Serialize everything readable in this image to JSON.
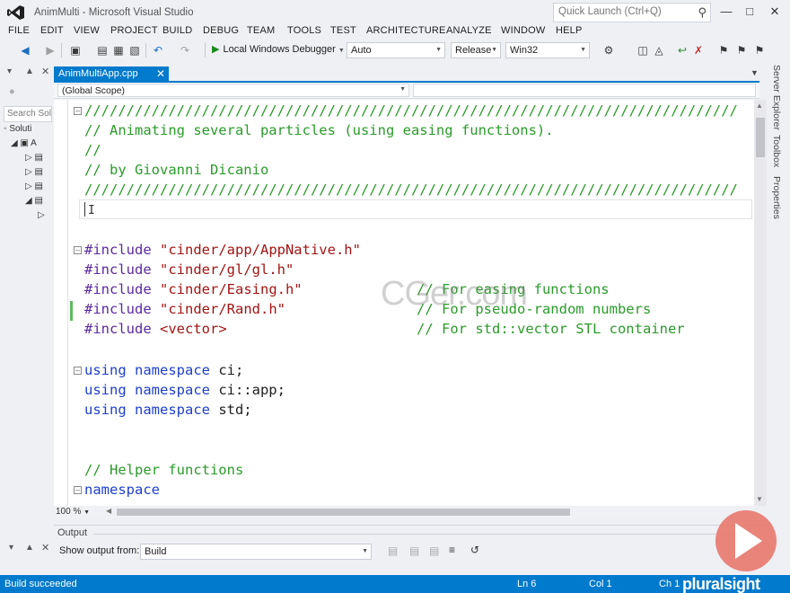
{
  "window": {
    "title": "AnimMulti - Microsoft Visual Studio",
    "quick_launch_placeholder": "Quick Launch (Ctrl+Q)"
  },
  "menu": [
    "FILE",
    "EDIT",
    "VIEW",
    "PROJECT",
    "BUILD",
    "DEBUG",
    "TEAM",
    "TOOLS",
    "TEST",
    "ARCHITECTURE",
    "ANALYZE",
    "WINDOW",
    "HELP"
  ],
  "toolbar": {
    "debugger_label": "Local Windows Debugger",
    "config_auto": "Auto",
    "config_release": "Release",
    "platform": "Win32"
  },
  "solution_explorer": {
    "search_placeholder": "Search Sol",
    "root_label": "Soluti"
  },
  "document_tab": {
    "filename": "AnimMultiApp.cpp"
  },
  "navigation": {
    "scope": "(Global Scope)"
  },
  "code_lines": [
    {
      "t": "//////////////////////////////////////////////////////////////////////////////",
      "k": "comment"
    },
    {
      "t": "// Animating several particles (using easing functions).",
      "k": "comment"
    },
    {
      "t": "//",
      "k": "comment"
    },
    {
      "t": "// by Giovanni Dicanio",
      "k": "comment"
    },
    {
      "t": "//////////////////////////////////////////////////////////////////////////////",
      "k": "comment"
    }
  ],
  "includes": [
    {
      "kw": "#include ",
      "file": "\"cinder/app/AppNative.h\"",
      "comment": ""
    },
    {
      "kw": "#include ",
      "file": "\"cinder/gl/gl.h\"",
      "comment": ""
    },
    {
      "kw": "#include ",
      "file": "\"cinder/Easing.h\"",
      "comment": "// For easing functions"
    },
    {
      "kw": "#include ",
      "file": "\"cinder/Rand.h\"",
      "comment": "// For pseudo-random numbers"
    },
    {
      "kw": "#include ",
      "file": "<vector>",
      "comment": "// For std::vector STL container"
    }
  ],
  "usings": [
    {
      "kw": "using namespace ",
      "name": "ci;"
    },
    {
      "kw": "using namespace ",
      "name": "ci::app;"
    },
    {
      "kw": "using namespace ",
      "name": "std;"
    }
  ],
  "helper_comment": "// Helper functions",
  "namespace_kw": "namespace",
  "watermark": "CGer.com",
  "zoom": "100 %",
  "output": {
    "title": "Output",
    "show_from_label": "Show output from:",
    "show_from_value": "Build"
  },
  "right_tabs": [
    "Server Explorer",
    "Toolbox",
    "Properties"
  ],
  "status": {
    "message": "Build succeeded",
    "line": "Ln 6",
    "col": "Col 1",
    "ch": "Ch 1",
    "brand": "pluralsight"
  }
}
